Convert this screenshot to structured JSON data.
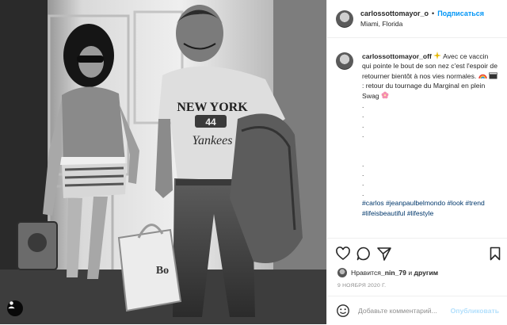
{
  "header": {
    "username": "carlossottomayor_o",
    "separator": "•",
    "follow_label": "Подписаться",
    "location": "Miami, Florida"
  },
  "caption": {
    "username": "carlossottomayor_off",
    "text_1": " Avec ce vaccin qui pointe le bout de son nez c'est l'espoir de retourner bientôt à nos vies normales. ",
    "text_2": ": retour du tournage du Marginal en plein Swag ",
    "dot": ".",
    "hashtags": "#carlos #jeanpaulbelmondo #look #trend #lifeisbeautiful #lifestyle"
  },
  "photo": {
    "shirt_line1": "NEW YORK",
    "shirt_number": "44",
    "shirt_line2": "Yankees",
    "bag_text": "Bo"
  },
  "likes": {
    "prefix": "Нравится ",
    "user": "_nin_79",
    "middle": " и ",
    "others": "другим"
  },
  "date": "9 НОЯБРЯ 2020 Г.",
  "comment": {
    "placeholder": "Добавьте комментарий...",
    "post_label": "Опубликовать"
  },
  "colors": {
    "accent": "#0095f6",
    "post_disabled": "#b2dffc",
    "border": "#efefef",
    "muted": "#8e8e8e"
  },
  "icons": [
    "heart-icon",
    "comment-icon",
    "share-icon",
    "bookmark-icon",
    "emoji-icon",
    "user-tag-icon",
    "sparkle-emoji-icon",
    "rainbow-emoji-icon",
    "clapperboard-emoji-icon",
    "cherry-blossom-emoji-icon"
  ]
}
